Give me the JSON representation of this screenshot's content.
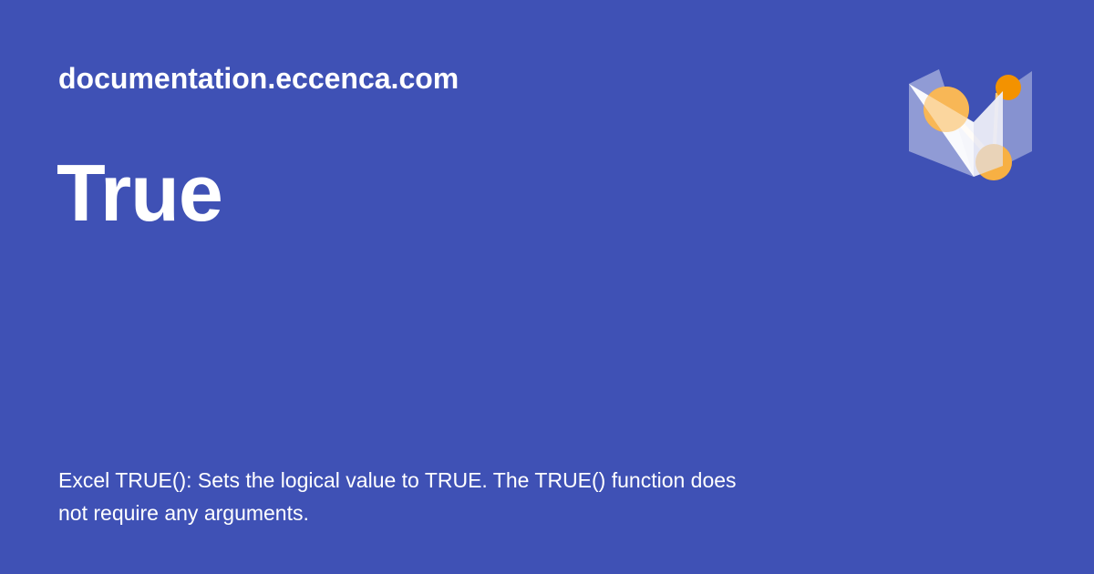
{
  "header": {
    "site_url": "documentation.eccenca.com",
    "logo_icon": "eccenca-logo-icon"
  },
  "main": {
    "title": "True",
    "description": "Excel TRUE(): Sets the logical value to TRUE. The TRUE() function does not require any arguments."
  },
  "colors": {
    "background": "#3f51b5",
    "text": "#ffffff",
    "logo_orange": "#f39200",
    "logo_light_orange": "#f9c87a",
    "logo_lavender": "#9fa8da"
  }
}
